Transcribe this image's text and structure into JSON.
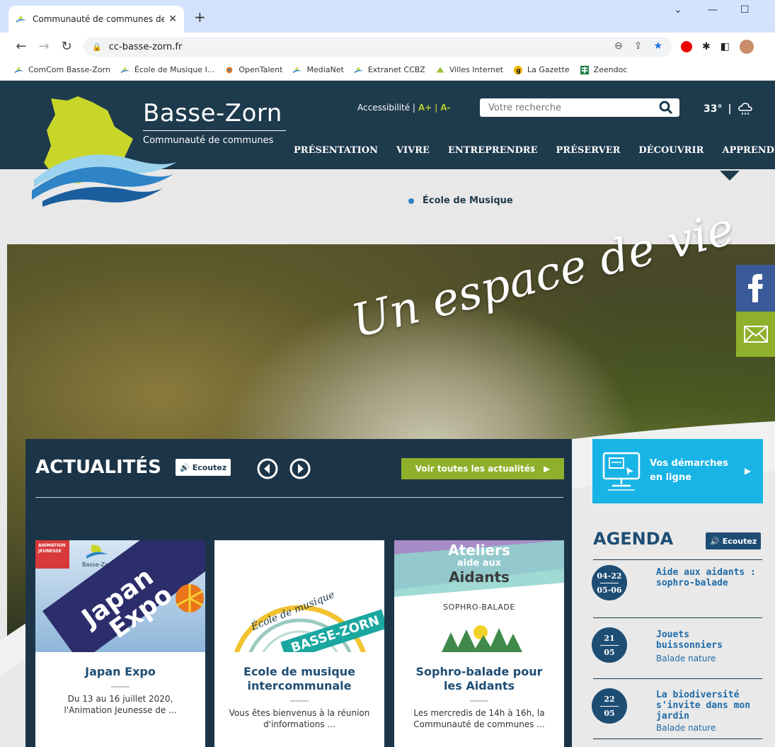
{
  "browser": {
    "tab_title": "Communauté de communes de B",
    "url": "cc-basse-zorn.fr",
    "bookmarks": [
      "ComCom Basse-Zorn",
      "École de Musique I...",
      "OpenTalent",
      "MediaNet",
      "Extranet CCBZ",
      "Villes Internet",
      "La Gazette",
      "Zeendoc"
    ]
  },
  "header": {
    "brand_title": "Basse-Zorn",
    "brand_subtitle": "Communauté de communes",
    "accessibility_label": "Accessibilité |",
    "a_plus": "A+",
    "sep": "|",
    "a_minus": "A-",
    "search_placeholder": "Votre recherche",
    "temperature": "33°",
    "weather_sep": "|",
    "nav": [
      "PRÉSENTATION",
      "VIVRE",
      "ENTREPRENDRE",
      "PRÉSERVER",
      "DÉCOUVRIR",
      "APPRENDRE"
    ]
  },
  "breadcrumb": "École de Musique",
  "hero": {
    "script_text": "Un espace de vie"
  },
  "news": {
    "title": "ACTUALITÉS",
    "listen_label": "Ecoutez",
    "view_all": "Voir toutes les actualités",
    "cards": [
      {
        "title": "Japan Expo",
        "text": "Du  13 au 16 juillet 2020, l'Animation Jeunesse de ...",
        "img_word1": "Japan",
        "img_word2": "Expo",
        "img_logo": "Basse-Zorn",
        "img_badge": "ANIMATION JEUNESSE"
      },
      {
        "title": "Ecole de musique intercommunale",
        "text": "Vous êtes bienvenus à la réunion d'informations ...",
        "img_word1": "École de musique",
        "img_word2": "BASSE-ZORN"
      },
      {
        "title": "Sophro-balade pour les Aidants",
        "text": "Les mercredis de 14h à 16h, la Communauté de communes ...",
        "img_word1": "Ateliers",
        "img_word2": "aide aux",
        "img_word3": "Aidants",
        "img_word4": "SOPHRO-BALADE"
      }
    ]
  },
  "demarches": {
    "line1": "Vos démarches",
    "line2": "en ligne"
  },
  "agenda": {
    "title": "AGENDA",
    "listen_label": "Ecoutez",
    "items": [
      {
        "date_top": "04-22",
        "date_bottom": "05-06",
        "title": "Aide aux aidants : sophro-balade",
        "sub": ""
      },
      {
        "date_top": "21",
        "date_bottom": "05",
        "title": "Jouets buissonniers",
        "sub": "Balade nature"
      },
      {
        "date_top": "22",
        "date_bottom": "05",
        "title": "La biodiversité s'invite dans mon jardin",
        "sub": "Balade nature"
      }
    ]
  },
  "colors": {
    "navy": "#1e3a4d",
    "green": "#8fb02a",
    "cyan": "#19b4e6",
    "blue_text": "#1e4d74"
  }
}
